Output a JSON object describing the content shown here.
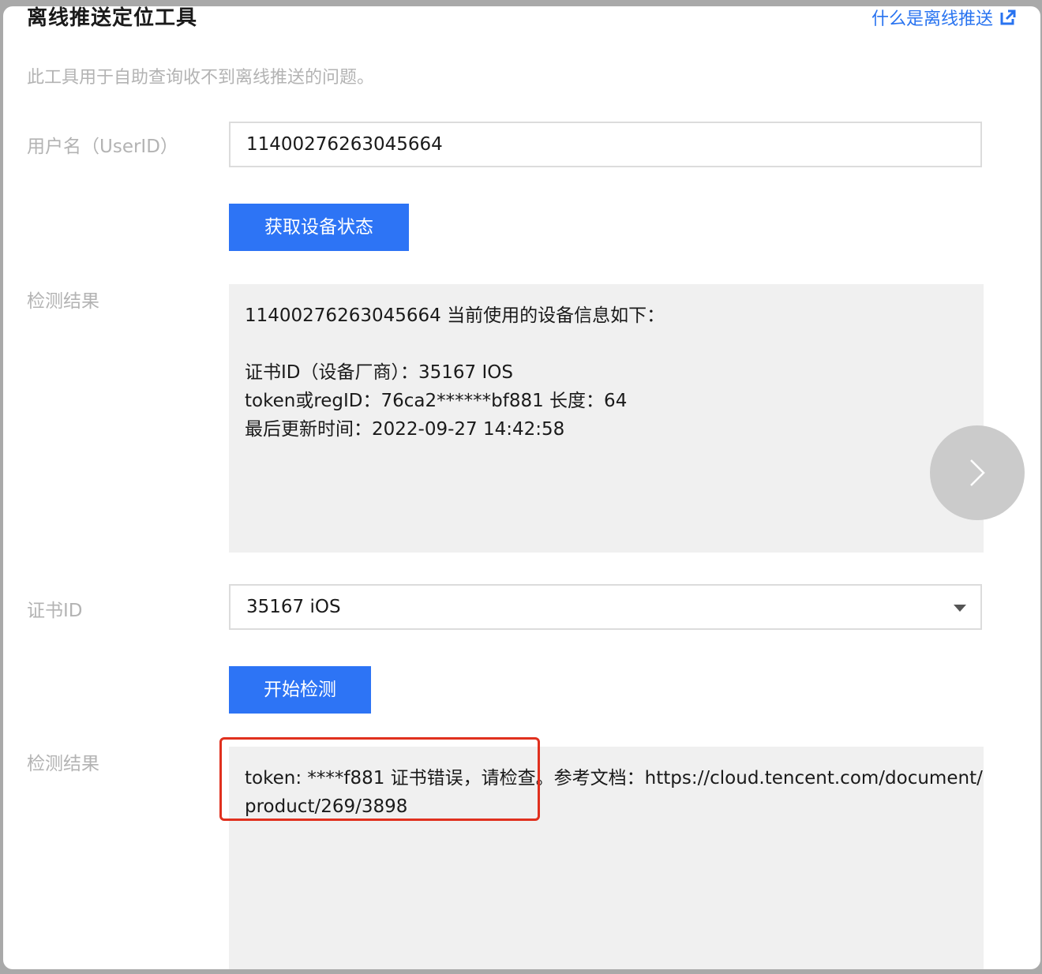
{
  "dialog": {
    "title": "离线推送定位工具",
    "help_link": "什么是离线推送",
    "description": "此工具用于自助查询收不到离线推送的问题。"
  },
  "user_section": {
    "label": "用户名（UserID）",
    "value": "11400276263045664",
    "button_label": "获取设备状态"
  },
  "device_result": {
    "label": "检测结果",
    "line1": "11400276263045664 当前使用的设备信息如下：",
    "line2": "证书ID（设备厂商）：35167 IOS",
    "line3": "token或regID：76ca2******bf881 长度：64",
    "line4": "最后更新时间：2022-09-27 14:42:58"
  },
  "cert_section": {
    "label": "证书ID",
    "selected_value": "35167 iOS",
    "button_label": "开始检测"
  },
  "check_result": {
    "label": "检测结果",
    "line1": "token: ****f881 证书错误，请检查。参考文档：https://cloud.tencent.com/document/",
    "line2": "product/269/3898"
  },
  "icons": {
    "external_link": "external-link-icon",
    "dropdown": "chevron-down-icon",
    "next": "chevron-right-icon"
  },
  "colors": {
    "primary": "#2d74f5",
    "link": "#2873f0",
    "highlight": "#e0301e"
  }
}
